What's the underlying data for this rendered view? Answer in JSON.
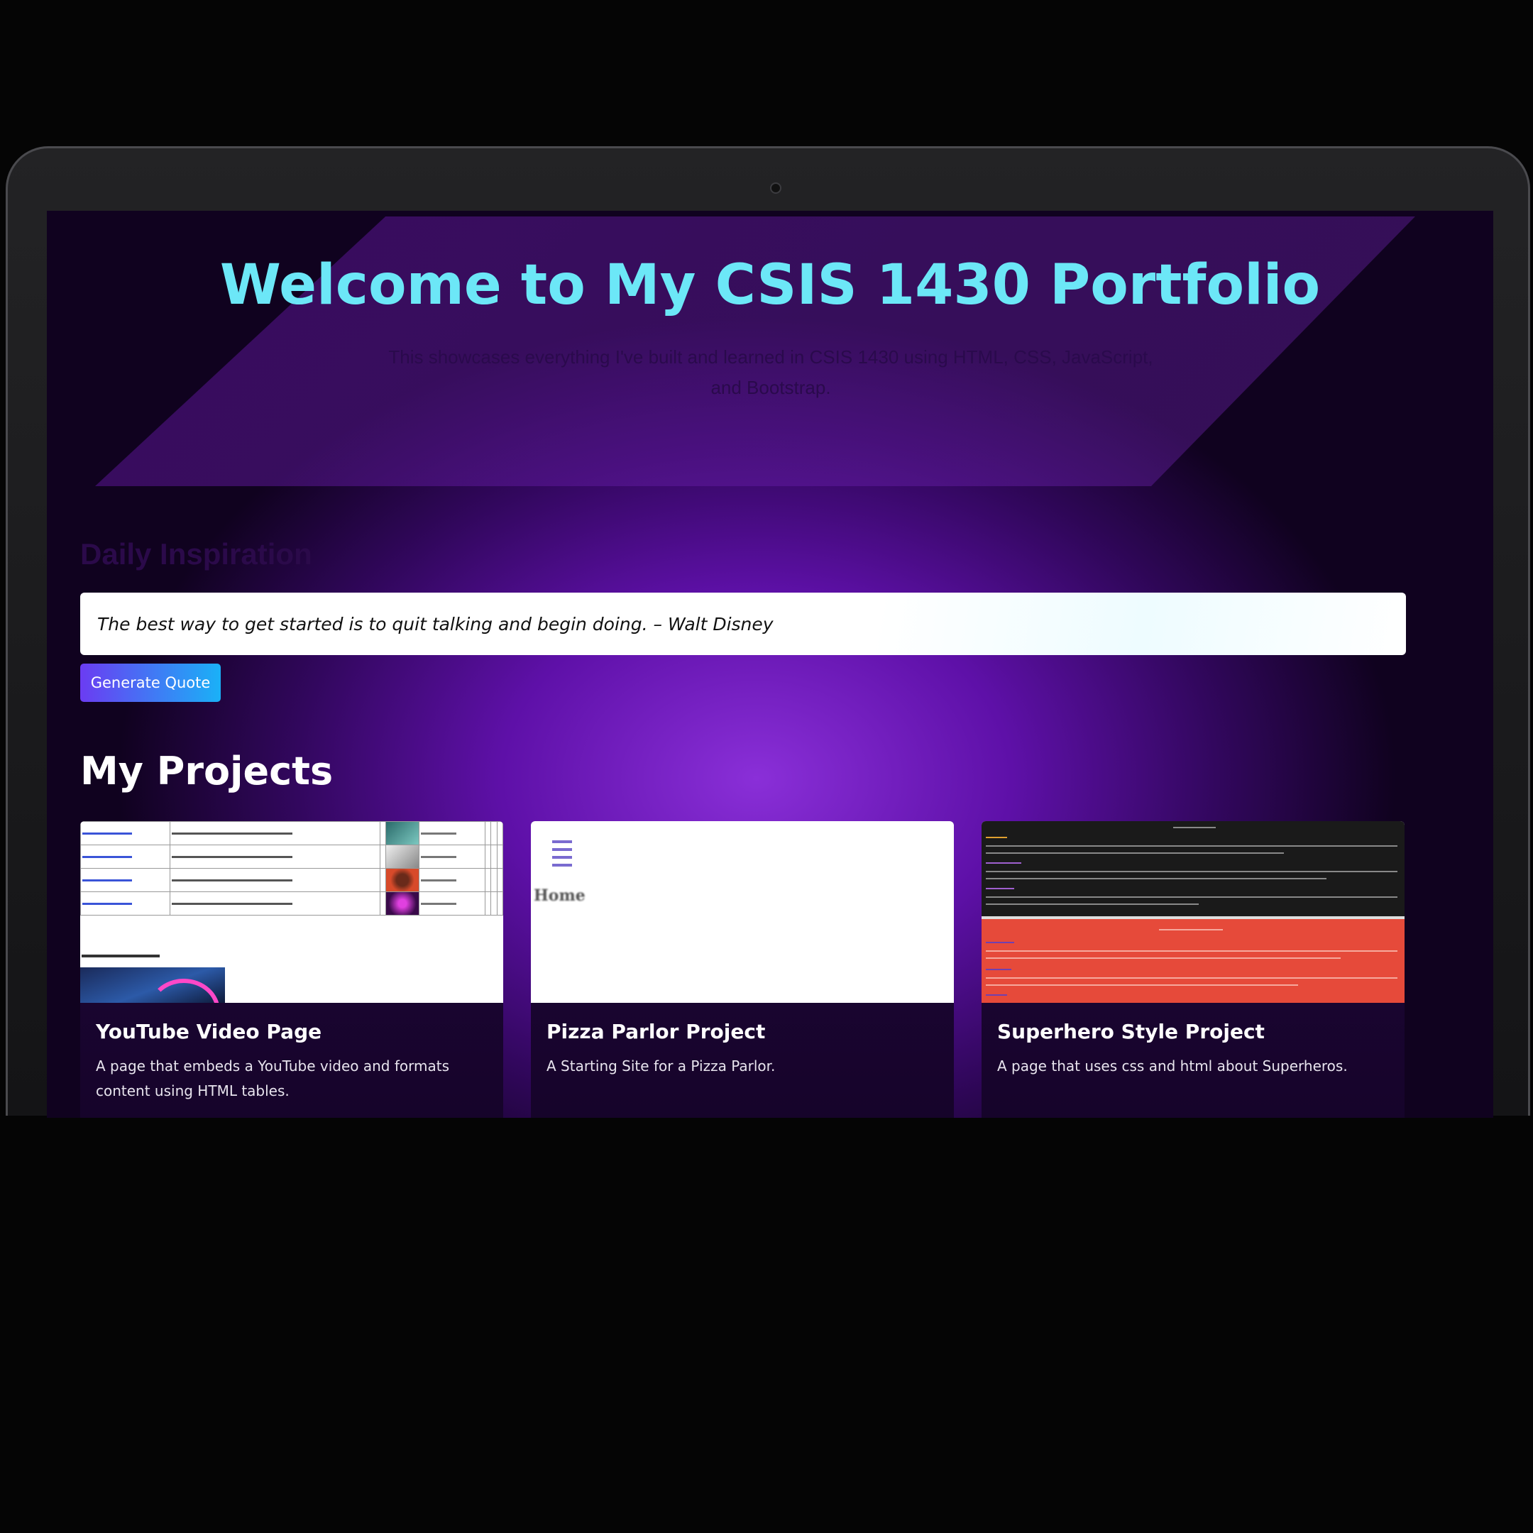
{
  "hero": {
    "title": "Welcome to My CSIS 1430 Portfolio",
    "subtitle": "This showcases everything I've built and learned in CSIS 1430 using HTML, CSS, JavaScript, and Bootstrap."
  },
  "inspiration": {
    "heading": "Daily Inspiration",
    "quote": "The best way to get started is to quit talking and begin doing. – Walt Disney",
    "button_label": "Generate Quote"
  },
  "projects": {
    "heading": "My Projects",
    "cards": [
      {
        "title": "YouTube Video Page",
        "description": "A page that embeds a YouTube video and formats content using HTML tables."
      },
      {
        "title": "Pizza Parlor Project",
        "description": "A Starting Site for a Pizza Parlor."
      },
      {
        "title": "Superhero Style Project",
        "description": "A page that uses css and html about Superheros."
      }
    ]
  },
  "colors": {
    "title_cyan": "#6ce7f7",
    "button_start": "#6b3cf2",
    "button_end": "#1ab1f7",
    "background_purple": "#5e10a8"
  }
}
